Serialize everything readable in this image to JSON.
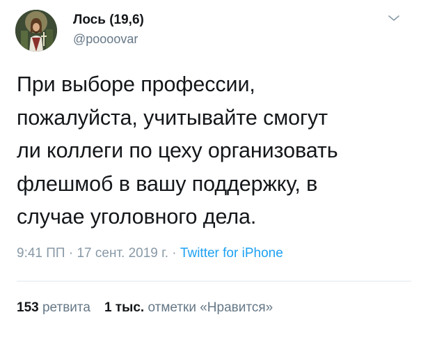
{
  "author": {
    "display_name": "Лось (19,6)",
    "handle": "@poooovar"
  },
  "tweet": {
    "lines": [
      "При выборе профессии,",
      "пожалуйста, учитывайте смогут",
      "ли коллеги по цеху организовать",
      "флешмоб в вашу поддержку, в",
      "случае уголовного дела."
    ]
  },
  "meta": {
    "time": "9:41 ПП",
    "separator1": " · ",
    "date": "17 сент. 2019 г.",
    "separator2": " · ",
    "source": "Twitter for iPhone"
  },
  "stats": {
    "retweets_count": "153",
    "retweets_label": "ретвита",
    "likes_count": "1 тыс.",
    "likes_label": "отметки «Нравится»"
  },
  "icons": {
    "menu": "chevron-down-icon",
    "avatar": "avatar"
  },
  "colors": {
    "text": "#14171a",
    "secondary": "#657786",
    "meta": "#8899a6",
    "link": "#1da1f2",
    "divider": "#e1e8ed"
  }
}
